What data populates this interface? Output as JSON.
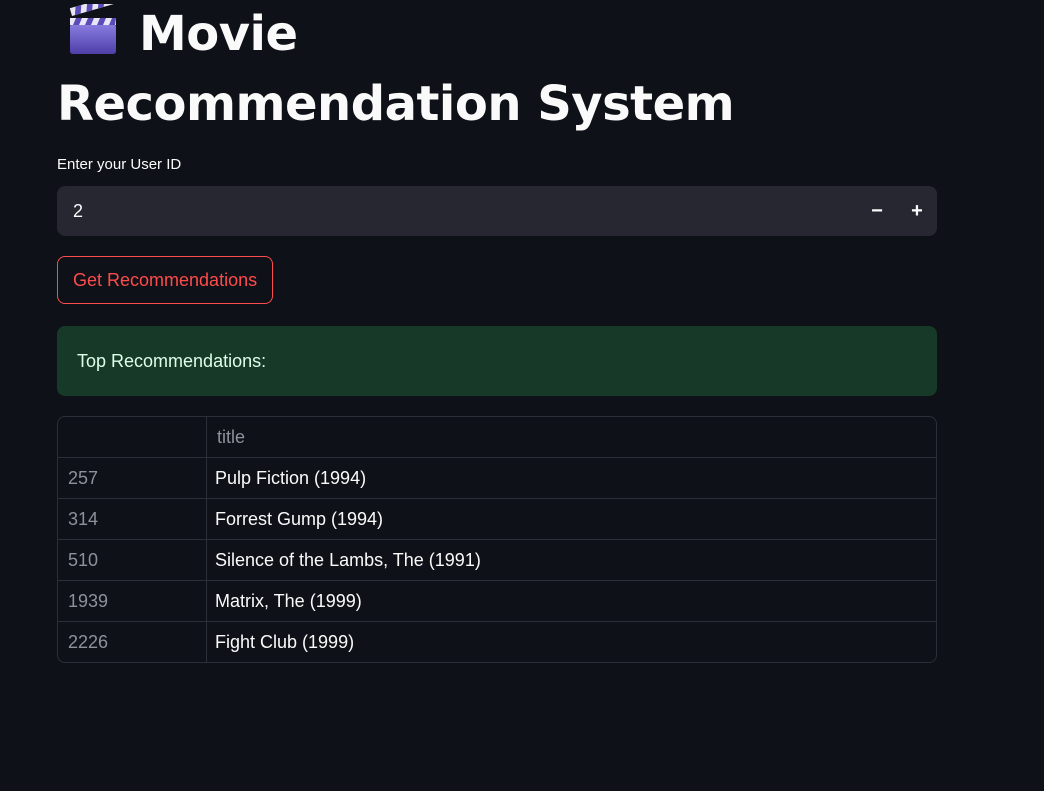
{
  "header": {
    "title": "Movie Recommendation System",
    "icon": "clapper-board-icon"
  },
  "user_input": {
    "label": "Enter your User ID",
    "value": "2",
    "decrement_label": "−",
    "increment_label": "+"
  },
  "actions": {
    "recommend_label": "Get Recommendations"
  },
  "result": {
    "message": "Top Recommendations:"
  },
  "table": {
    "columns": [
      "",
      "title"
    ],
    "rows": [
      {
        "index": "257",
        "title": "Pulp Fiction (1994)"
      },
      {
        "index": "314",
        "title": "Forrest Gump (1994)"
      },
      {
        "index": "510",
        "title": "Silence of the Lambs, The (1991)"
      },
      {
        "index": "1939",
        "title": "Matrix, The (1999)"
      },
      {
        "index": "2226",
        "title": "Fight Club (1999)"
      }
    ]
  },
  "colors": {
    "background": "#0e1117",
    "input_background": "#262730",
    "accent": "#ff4b4b",
    "success_background": "#173928",
    "success_text": "#dffde9"
  }
}
